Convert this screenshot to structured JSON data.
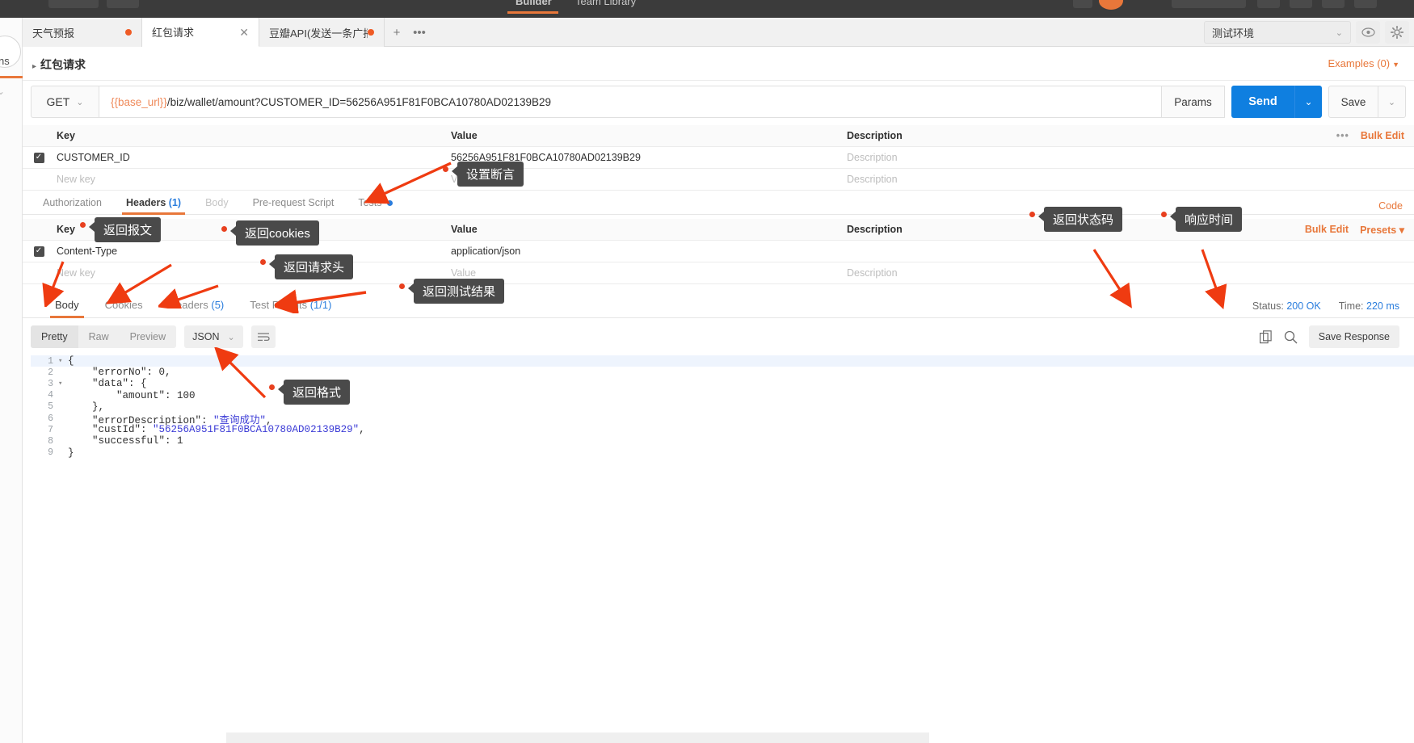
{
  "topbar": {
    "nav": [
      {
        "label": "Builder",
        "active": true
      },
      {
        "label": "Team Library",
        "active": false
      }
    ]
  },
  "sidebar": {
    "label": "ns"
  },
  "tabstrip": {
    "tabs": [
      {
        "name": "天气预报",
        "unsaved": true,
        "active": false
      },
      {
        "name": "红包请求",
        "unsaved": false,
        "active": true,
        "closable": true
      },
      {
        "name": "豆瓣API(发送一条广播",
        "unsaved": true,
        "active": false
      }
    ],
    "add_label": "+",
    "more_label": "•••",
    "environment": {
      "selected": "测试环境",
      "caret": "⌄"
    },
    "eye_icon": "eye-icon",
    "gear_icon": "gear-icon"
  },
  "request_header": {
    "breadcrumb": "红包请求",
    "examples": "Examples (0)"
  },
  "urlbar": {
    "method": "GET",
    "url_variable": "{{base_url}}",
    "url_rest": "/biz/wallet/amount?CUSTOMER_ID=56256A951F81F0BCA10780AD02139B29",
    "params_label": "Params",
    "send_label": "Send",
    "save_label": "Save"
  },
  "params_table": {
    "columns": {
      "key": "Key",
      "value": "Value",
      "description": "Description"
    },
    "bulk_edit": "Bulk Edit",
    "dots": "•••",
    "rows": [
      {
        "checked": true,
        "key": "CUSTOMER_ID",
        "value": "56256A951F81F0BCA10780AD02139B29",
        "description": "",
        "description_placeholder": "Description"
      },
      {
        "checked": false,
        "key": "",
        "key_placeholder": "New key",
        "value": "",
        "value_placeholder": "Value",
        "description": "",
        "description_placeholder": "Description"
      }
    ]
  },
  "request_tabs": {
    "items": [
      {
        "label": "Authorization",
        "count": "",
        "active": false
      },
      {
        "label": "Headers",
        "count": "(1)",
        "active": true
      },
      {
        "label": "Body",
        "count": "",
        "active": false,
        "disabled": true
      },
      {
        "label": "Pre-request Script",
        "count": "",
        "active": false
      },
      {
        "label": "Tests",
        "count": "",
        "active": false,
        "dot": true
      }
    ],
    "code_link": "Code"
  },
  "headers_table": {
    "columns": {
      "key": "Key",
      "value": "Value",
      "description": "Description"
    },
    "bulk_edit": "Bulk Edit",
    "presets": "Presets",
    "rows": [
      {
        "checked": true,
        "key": "Content-Type",
        "value": "application/json",
        "description": "",
        "description_placeholder": ""
      },
      {
        "checked": false,
        "key": "",
        "key_placeholder": "New key",
        "value": "",
        "value_placeholder": "Value",
        "description": "",
        "description_placeholder": "Description"
      }
    ]
  },
  "response_tabs": {
    "items": [
      {
        "label": "Body",
        "count": "",
        "active": true
      },
      {
        "label": "Cookies",
        "count": "",
        "active": false
      },
      {
        "label": "Headers",
        "count": "(5)",
        "active": false
      },
      {
        "label": "Test Results",
        "count": "(1/1)",
        "active": false
      }
    ],
    "status_label": "Status:",
    "status_value": "200 OK",
    "time_label": "Time:",
    "time_value": "220 ms"
  },
  "body_toolbar": {
    "views": [
      {
        "label": "Pretty",
        "active": true
      },
      {
        "label": "Raw",
        "active": false
      },
      {
        "label": "Preview",
        "active": false
      }
    ],
    "format": "JSON",
    "wrap_icon": "wrap-lines-icon",
    "copy_icon": "copy-icon",
    "search_icon": "search-icon",
    "save_response": "Save Response"
  },
  "response_body": {
    "language": "json",
    "lines": [
      {
        "no": "1",
        "fold": "▾",
        "text": "{",
        "highlight": true
      },
      {
        "no": "2",
        "fold": "",
        "text": "    \"errorNo\": 0,"
      },
      {
        "no": "3",
        "fold": "▾",
        "text": "    \"data\": {"
      },
      {
        "no": "4",
        "fold": "",
        "text": "        \"amount\": 100"
      },
      {
        "no": "5",
        "fold": "",
        "text": "    },"
      },
      {
        "no": "6",
        "fold": "",
        "text": "    \"errorDescription\": \"查询成功\","
      },
      {
        "no": "7",
        "fold": "",
        "text": "    \"custId\": \"56256A951F81F0BCA10780AD02139B29\","
      },
      {
        "no": "8",
        "fold": "",
        "text": "    \"successful\": 1"
      },
      {
        "no": "9",
        "fold": "",
        "text": "}"
      }
    ]
  },
  "annotations": [
    {
      "id": "set-assertion",
      "text": "设置断言"
    },
    {
      "id": "return-payload",
      "text": "返回报文"
    },
    {
      "id": "return-cookies",
      "text": "返回cookies"
    },
    {
      "id": "return-request-headers",
      "text": "返回请求头"
    },
    {
      "id": "return-test-results",
      "text": "返回测试结果"
    },
    {
      "id": "return-status-code",
      "text": "返回状态码"
    },
    {
      "id": "response-time",
      "text": "响应时间"
    },
    {
      "id": "return-format",
      "text": "返回格式"
    }
  ],
  "colors": {
    "accent": "#e8773a",
    "send_blue": "#0f7fe0",
    "status_blue": "#2a7ddd",
    "annotation_bg": "#4a4a4a",
    "arrow_red": "#ef3b11"
  }
}
